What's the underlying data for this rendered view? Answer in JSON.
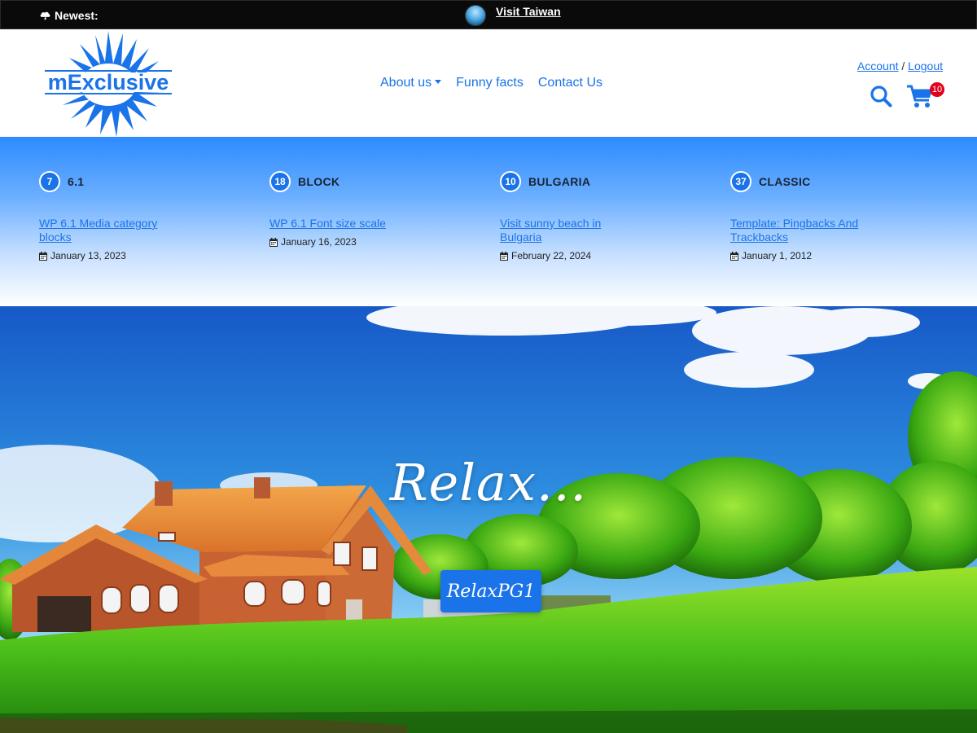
{
  "topbar": {
    "newest_label": "Newest:",
    "ticker_link": "Visit Taiwan"
  },
  "header": {
    "logo_text": "mExclusive",
    "nav": [
      {
        "label": "About us",
        "has_dropdown": true
      },
      {
        "label": "Funny facts"
      },
      {
        "label": "Contact Us"
      }
    ],
    "account_label": "Account",
    "separator": "/",
    "logout_label": "Logout",
    "cart_count": "10",
    "icons": [
      "search-icon",
      "cart-icon"
    ]
  },
  "categories": [
    {
      "count": "7",
      "name": "6.1",
      "post_title": "WP 6.1 Media category blocks",
      "date": "January 13, 2023"
    },
    {
      "count": "18",
      "name": "BLOCK",
      "post_title": "WP 6.1 Font size scale",
      "date": "January 16, 2023"
    },
    {
      "count": "10",
      "name": "BULGARIA",
      "post_title": "Visit sunny beach in Bulgaria",
      "date": "February 22, 2024"
    },
    {
      "count": "37",
      "name": "CLASSIC",
      "post_title": "Template: Pingbacks And Trackbacks",
      "date": "January 1, 2012"
    }
  ],
  "hero": {
    "title": "Relax...",
    "button_label": "RelaxPG1"
  },
  "colors": {
    "accent": "#1a73e8",
    "topbar_bg": "#0a0a0a",
    "badge": "#e0001a"
  }
}
